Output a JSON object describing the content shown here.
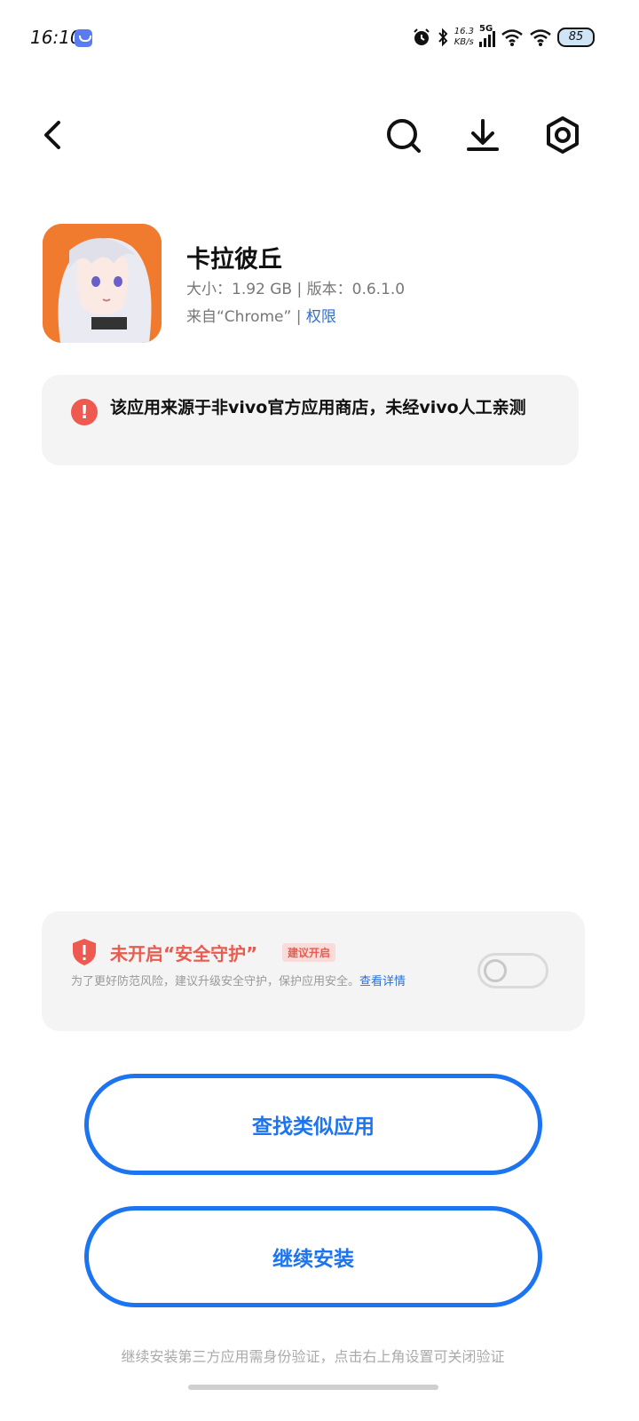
{
  "status_bar": {
    "time": "16:10",
    "speed_value": "16.3",
    "speed_unit": "KB/s",
    "network": "5G",
    "battery": "85"
  },
  "app": {
    "name": "卡拉彼丘",
    "meta": "大小：1.92 GB | 版本：0.6.1.0",
    "source_text": "来自“Chrome” | ",
    "permission_link": "权限"
  },
  "warning": {
    "text": "该应用来源于非vivo官方应用商店，未经vivo人工亲测"
  },
  "safety": {
    "title": "未开启“安全守护”",
    "tag": "建议开启",
    "desc": "为了更好防范风险，建议升级安全守护，保护应用安全。",
    "link": "查看详情",
    "toggle_on": false
  },
  "buttons": {
    "find_similar": "查找类似应用",
    "continue_install": "继续安装"
  },
  "footer": {
    "note": "继续安装第三方应用需身份验证，点击右上角设置可关闭验证"
  },
  "colors": {
    "accent": "#1d74f0",
    "warning_red": "#ef5a50",
    "link_blue": "#2b6fd6"
  }
}
